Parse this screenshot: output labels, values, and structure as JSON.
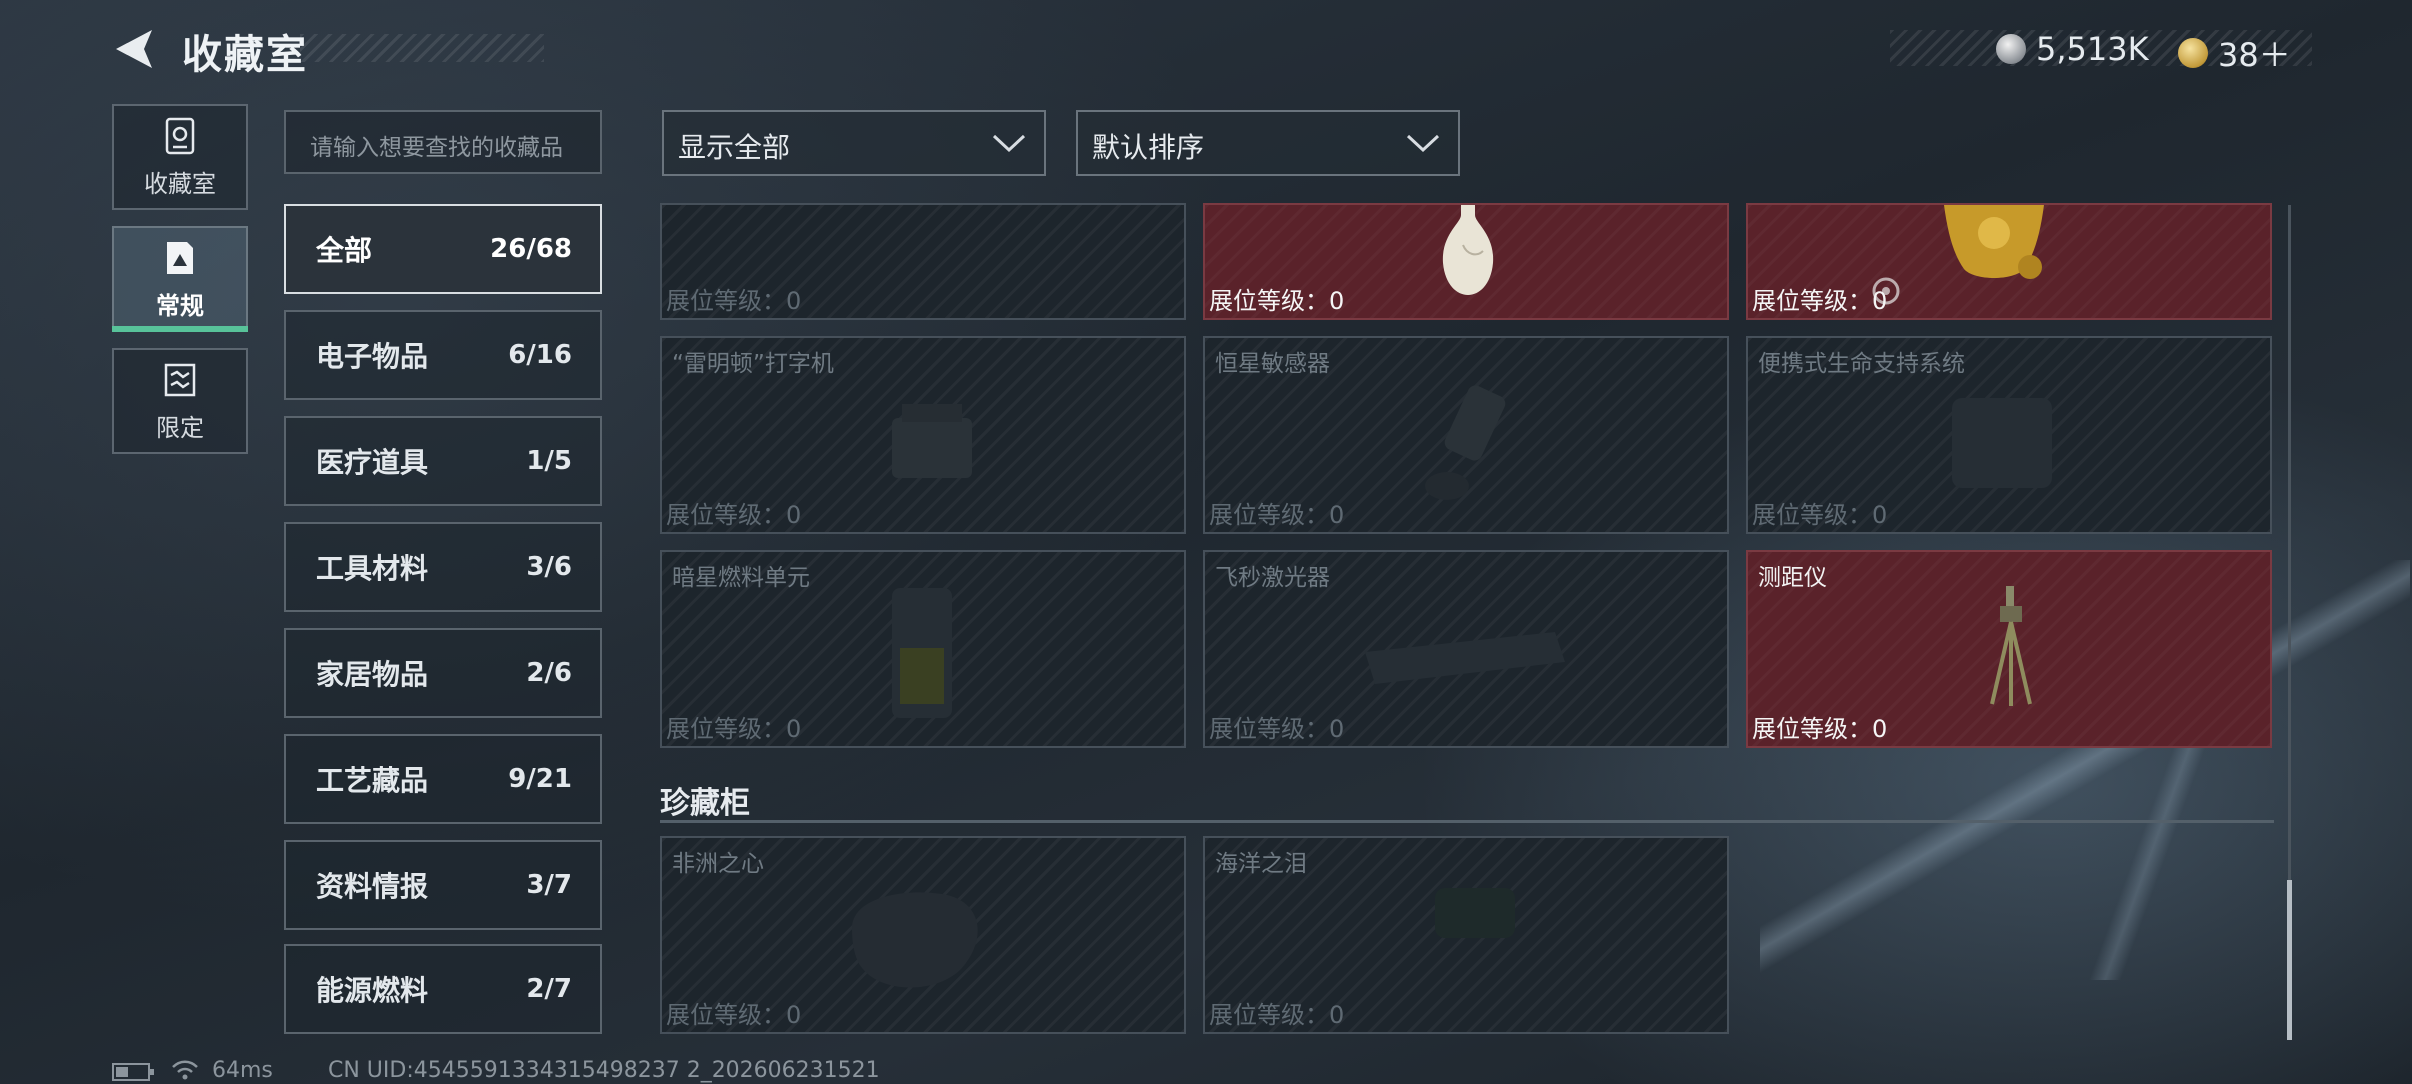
{
  "header": {
    "title": "收藏室",
    "currency_1": "5,513K",
    "currency_2": "38＋"
  },
  "rail": {
    "items": [
      {
        "label": "收藏室",
        "icon": "vault-icon"
      },
      {
        "label": "常规",
        "icon": "regular-icon",
        "active": true
      },
      {
        "label": "限定",
        "icon": "limited-icon"
      }
    ]
  },
  "search": {
    "placeholder": "请输入想要查找的收藏品"
  },
  "categories": [
    {
      "name": "全部",
      "count": "26/68",
      "active": true
    },
    {
      "name": "电子物品",
      "count": "6/16"
    },
    {
      "name": "医疗道具",
      "count": "1/5"
    },
    {
      "name": "工具材料",
      "count": "3/6"
    },
    {
      "name": "家居物品",
      "count": "2/6"
    },
    {
      "name": "工艺藏品",
      "count": "9/21"
    },
    {
      "name": "资料情报",
      "count": "3/7"
    },
    {
      "name": "能源燃料",
      "count": "2/7"
    }
  ],
  "filters": {
    "filter_label": "显示全部",
    "sort_label": "默认排序"
  },
  "grid": {
    "level_label": "展位等级：0",
    "items": [
      {
        "name": "",
        "owned": false
      },
      {
        "name": "",
        "owned": true
      },
      {
        "name": "",
        "owned": true
      },
      {
        "name": "“雷明顿”打字机",
        "owned": false
      },
      {
        "name": "恒星敏感器",
        "owned": false
      },
      {
        "name": "便携式生命支持系统",
        "owned": false
      },
      {
        "name": "暗星燃料单元",
        "owned": false
      },
      {
        "name": "飞秒激光器",
        "owned": false
      },
      {
        "name": "测距仪",
        "owned": true
      }
    ]
  },
  "treasure": {
    "title": "珍藏柜",
    "items": [
      {
        "name": "非洲之心",
        "owned": false
      },
      {
        "name": "海洋之泪",
        "owned": false
      }
    ]
  },
  "status_bar": {
    "ping": "64ms",
    "uid": "CN UID:4545591334315498237 2_202606231521"
  },
  "colors": {
    "owned_card": "#5a222a",
    "locked_card": "#1d252c",
    "active_accent": "#58c39a"
  }
}
